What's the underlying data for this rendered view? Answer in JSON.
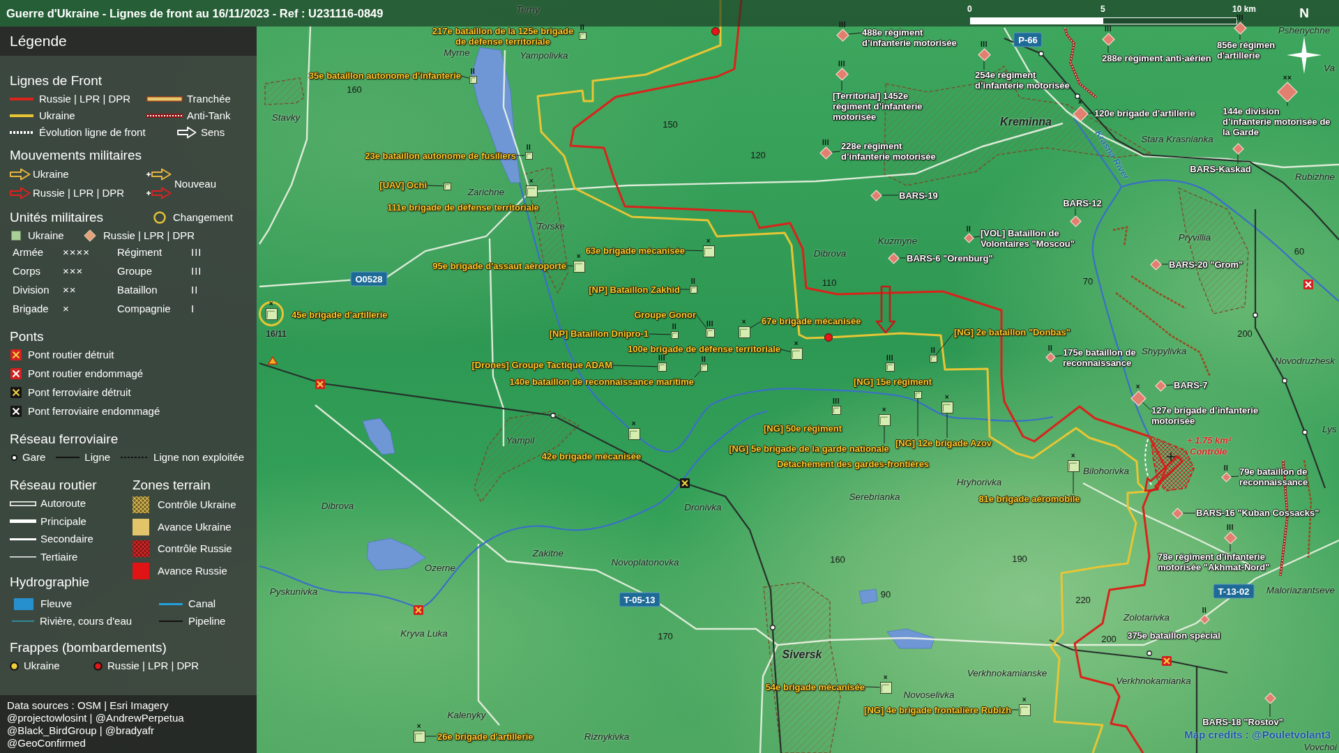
{
  "title": "Guerre d'Ukraine - Lignes de front au 16/11/2023 - Ref : U231116-0849",
  "scale_bar": {
    "ticks": [
      "0",
      "5",
      "10 km"
    ]
  },
  "compass": {
    "label": "N"
  },
  "legend": {
    "heading": "Légende",
    "front_lines": {
      "title": "Lignes de Front",
      "items": [
        {
          "kind": "russia",
          "label": "Russie | LPR | DPR"
        },
        {
          "kind": "trench",
          "label": "Tranchée"
        },
        {
          "kind": "ukraine",
          "label": "Ukraine"
        },
        {
          "kind": "anti-tank",
          "label": "Anti-Tank"
        },
        {
          "kind": "evolution",
          "label": "Évolution ligne de front"
        },
        {
          "kind": "direction",
          "label": "Sens"
        }
      ]
    },
    "movements": {
      "title": "Mouvements militaires",
      "items": [
        {
          "kind": "ukraine",
          "label": "Ukraine"
        },
        {
          "kind": "russia",
          "label": "Russie | LPR | DPR"
        }
      ],
      "new_label": "Nouveau"
    },
    "units": {
      "title": "Unités militaires",
      "change_label": "Changement",
      "sides": [
        {
          "kind": "ukraine",
          "label": "Ukraine"
        },
        {
          "kind": "russia",
          "label": "Russie | LPR | DPR"
        }
      ],
      "echelons": [
        {
          "label": "Armée",
          "mark": "××××"
        },
        {
          "label": "Régiment",
          "mark": "III"
        },
        {
          "label": "Corps",
          "mark": "×××"
        },
        {
          "label": "Groupe",
          "mark": "III"
        },
        {
          "label": "Division",
          "mark": "××"
        },
        {
          "label": "Bataillon",
          "mark": "II"
        },
        {
          "label": "Brigade",
          "mark": "×"
        },
        {
          "label": "Compagnie",
          "mark": "I"
        }
      ]
    },
    "bridges": {
      "title": "Ponts",
      "items": [
        {
          "kind": "road-destroyed",
          "label": "Pont routier détruit"
        },
        {
          "kind": "road-damaged",
          "label": "Pont routier endommagé"
        },
        {
          "kind": "rail-destroyed",
          "label": "Pont ferroviaire détruit"
        },
        {
          "kind": "rail-damaged",
          "label": "Pont ferroviaire endommagé"
        }
      ]
    },
    "railways": {
      "title": "Réseau ferroviaire",
      "items": [
        {
          "kind": "station",
          "label": "Gare"
        },
        {
          "kind": "line",
          "label": "Ligne"
        },
        {
          "kind": "disused",
          "label": "Ligne non exploitée"
        }
      ]
    },
    "roads": {
      "title": "Réseau routier",
      "items": [
        {
          "kind": "motorway",
          "label": "Autoroute"
        },
        {
          "kind": "primary",
          "label": "Principale"
        },
        {
          "kind": "secondary",
          "label": "Secondaire"
        },
        {
          "kind": "tertiary",
          "label": "Tertiaire"
        }
      ]
    },
    "zones": {
      "title": "Zones terrain",
      "items": [
        {
          "kind": "ukraine-control",
          "label": "Contrôle Ukraine"
        },
        {
          "kind": "ukraine-advance",
          "label": "Avance Ukraine"
        },
        {
          "kind": "russia-control",
          "label": "Contrôle Russie"
        },
        {
          "kind": "russia-advance",
          "label": "Avance Russie"
        }
      ]
    },
    "hydrography": {
      "title": "Hydrographie",
      "items": [
        {
          "kind": "river",
          "label": "Fleuve"
        },
        {
          "kind": "canal",
          "label": "Canal"
        },
        {
          "kind": "stream",
          "label": "Rivière, cours d'eau"
        },
        {
          "kind": "pipeline",
          "label": "Pipeline"
        }
      ]
    },
    "strikes": {
      "title": "Frappes (bombardements)",
      "items": [
        {
          "kind": "ukraine",
          "label": "Ukraine"
        },
        {
          "kind": "russia",
          "label": "Russie | LPR | DPR"
        }
      ]
    },
    "sources": [
      "Data sources : OSM | Esri Imagery",
      "@projectowlosint | @AndrewPerpetua",
      "@Black_BirdGroup | @bradyafr",
      "@GeoConfirmed"
    ]
  },
  "map": {
    "places": [
      {
        "name": "Terny",
        "kind": "village"
      },
      {
        "name": "Myrne",
        "kind": "village"
      },
      {
        "name": "Yampolivka",
        "kind": "village"
      },
      {
        "name": "Pshenychne",
        "kind": "village"
      },
      {
        "name": "Va",
        "kind": "village"
      },
      {
        "name": "Stavky",
        "kind": "village"
      },
      {
        "name": "Kreminna",
        "kind": "town"
      },
      {
        "name": "Stara Krasnianka",
        "kind": "village"
      },
      {
        "name": "Rubizhne",
        "kind": "village"
      },
      {
        "name": "Zarichne",
        "kind": "village"
      },
      {
        "name": "Torske",
        "kind": "village"
      },
      {
        "name": "Pryvillia",
        "kind": "village"
      },
      {
        "name": "Kuzmyne",
        "kind": "village"
      },
      {
        "name": "Dibrova",
        "kind": "village"
      },
      {
        "name": "Shypylivka",
        "kind": "village"
      },
      {
        "name": "Novodruzhesk",
        "kind": "village"
      },
      {
        "name": "Lys",
        "kind": "village"
      },
      {
        "name": "Yampil",
        "kind": "village"
      },
      {
        "name": "Bilohorivka",
        "kind": "village"
      },
      {
        "name": "Hryhorivka",
        "kind": "village"
      },
      {
        "name": "Serebrianka",
        "kind": "village"
      },
      {
        "name": "Dronivka",
        "kind": "village"
      },
      {
        "name": "Dibrova",
        "kind": "village"
      },
      {
        "name": "Zakitne",
        "kind": "village"
      },
      {
        "name": "Novoplatonovka",
        "kind": "village"
      },
      {
        "name": "Ozerne",
        "kind": "village"
      },
      {
        "name": "Maloriazantseve",
        "kind": "village"
      },
      {
        "name": "Pyskunivka",
        "kind": "village"
      },
      {
        "name": "Zolotarivka",
        "kind": "village"
      },
      {
        "name": "Kryva Luka",
        "kind": "village"
      },
      {
        "name": "Siversk",
        "kind": "town"
      },
      {
        "name": "Verkhnokamianske",
        "kind": "village"
      },
      {
        "name": "Verkhnokamianka",
        "kind": "village"
      },
      {
        "name": "Novoselivka",
        "kind": "village"
      },
      {
        "name": "Kalenyky",
        "kind": "village"
      },
      {
        "name": "Riznykivka",
        "kind": "village"
      },
      {
        "name": "Vovchoi",
        "kind": "village"
      }
    ],
    "elevations": [
      "160",
      "150",
      "120",
      "110",
      "70",
      "60",
      "200",
      "170",
      "160",
      "190",
      "90",
      "220",
      "200"
    ],
    "road_numbers": [
      "O0528",
      "P-66",
      "T-05-13",
      "T-13-02"
    ],
    "river_label": "Krasna River",
    "units": [
      {
        "kind": "ukraine-battalion",
        "mark": "II",
        "label": "217e bataillon de la 125e brigade\nde défense territoriale",
        "changed": false
      },
      {
        "kind": "ukraine-battalion",
        "mark": "II",
        "label": "35e bataillon autonome d’infanterie",
        "changed": false
      },
      {
        "kind": "ukraine-battalion",
        "mark": "II",
        "label": "23e bataillon autonome de fusiliers",
        "changed": false
      },
      {
        "kind": "ukraine-unit",
        "label": "[UAV] Ochi",
        "changed": false
      },
      {
        "kind": "ukraine-brigade",
        "mark": "×",
        "label": "111e brigade de défense territoriale",
        "changed": false
      },
      {
        "kind": "ukraine-brigade",
        "mark": "×",
        "label": "63e brigade mécanisée",
        "changed": false
      },
      {
        "kind": "ukraine-brigade",
        "mark": "×",
        "label": "95e brigade d'assaut aéroporté",
        "changed": false
      },
      {
        "kind": "ukraine-battalion",
        "mark": "II",
        "label": "[NP] Bataillon Zakhid",
        "changed": false
      },
      {
        "kind": "ukraine-brigade",
        "mark": "×",
        "label": "45e brigade d'artillerie",
        "changed": true,
        "change_date": "16/11"
      },
      {
        "kind": "ukraine-group",
        "mark": "III",
        "label": "Groupe Gonor",
        "changed": false
      },
      {
        "kind": "ukraine-battalion",
        "mark": "II",
        "label": "[NP] Bataillon Dnipro-1",
        "changed": false
      },
      {
        "kind": "ukraine-brigade",
        "mark": "×",
        "label": "67e brigade mécanisée",
        "changed": false
      },
      {
        "kind": "ukraine-brigade",
        "mark": "×",
        "label": "100e brigade de défense territoriale",
        "changed": false
      },
      {
        "kind": "ukraine-group",
        "mark": "III",
        "label": "[Drones] Groupe Tactique ADAM",
        "changed": false
      },
      {
        "kind": "ukraine-battalion",
        "mark": "II",
        "label": "140e bataillon de reconnaissance maritime",
        "changed": false
      },
      {
        "kind": "ukraine-brigade",
        "mark": "×",
        "label": "42e brigade mécanisée",
        "changed": false
      },
      {
        "kind": "ukraine-battalion",
        "mark": "II",
        "label": "[NG] 2e bataillon \"Donbas\"",
        "changed": false
      },
      {
        "kind": "ukraine-regiment",
        "mark": "III",
        "label": "[NG] 15e régiment",
        "changed": false
      },
      {
        "kind": "ukraine-regiment",
        "mark": "III",
        "label": "[NG] 50e régiment",
        "changed": false
      },
      {
        "kind": "ukraine-brigade",
        "mark": "×",
        "label": "[NG] 5e brigade de la garde nationale",
        "changed": false
      },
      {
        "kind": "ukraine-brigade",
        "mark": "×",
        "label": "[NG] 12e brigade Azov",
        "changed": false
      },
      {
        "kind": "ukraine-unit",
        "label": "Détachement des gardes-frontières",
        "changed": false
      },
      {
        "kind": "ukraine-brigade",
        "mark": "×",
        "label": "81e brigade aéromobile",
        "changed": false
      },
      {
        "kind": "ukraine-brigade",
        "mark": "×",
        "label": "54e brigade mécanisée",
        "changed": false
      },
      {
        "kind": "ukraine-brigade",
        "mark": "×",
        "label": "[NG] 4e brigade frontalière Rubizh",
        "changed": false
      },
      {
        "kind": "ukraine-brigade",
        "mark": "×",
        "label": "26e brigade d'artillerie",
        "changed": false
      },
      {
        "kind": "russia-regiment",
        "mark": "III",
        "label": "488e régiment\nd’infanterie motorisée",
        "changed": false
      },
      {
        "kind": "russia-regiment",
        "mark": "III",
        "label": "254e régiment\nd’infanterie motorisée",
        "changed": false
      },
      {
        "kind": "russia-regiment",
        "mark": "III",
        "label": "[Territorial] 1452e\nrégiment d’infanterie\nmotorisée",
        "changed": false
      },
      {
        "kind": "russia-regiment",
        "mark": "III",
        "label": "288e régiment anti-aérien",
        "changed": false
      },
      {
        "kind": "russia-regiment",
        "mark": "III",
        "label": "856e régimen\nd'artillerie",
        "changed": false
      },
      {
        "kind": "russia-brigade",
        "mark": "×",
        "label": "120e brigade d'artillerie",
        "changed": false
      },
      {
        "kind": "russia-division",
        "mark": "××",
        "label": "144e division\nd’infanterie motorisée de\nla Garde",
        "changed": false
      },
      {
        "kind": "russia-regiment",
        "mark": "III",
        "label": "228e régiment\nd’infanterie motorisée",
        "changed": false
      },
      {
        "kind": "russia-unit",
        "label": "BARS-Kaskad",
        "changed": false
      },
      {
        "kind": "russia-unit",
        "label": "BARS-19",
        "changed": false
      },
      {
        "kind": "russia-unit",
        "label": "BARS-12",
        "changed": false
      },
      {
        "kind": "russia-battalion",
        "mark": "II",
        "label": "[VOL] Bataillon de\nVolontaires \"Moscou\"",
        "changed": false
      },
      {
        "kind": "russia-unit",
        "label": "BARS-6 \"Orenburg\"",
        "changed": false
      },
      {
        "kind": "russia-unit",
        "label": "BARS-20 \"Grom\"",
        "changed": false
      },
      {
        "kind": "russia-battalion",
        "mark": "II",
        "label": "175e bataillon de\nreconnaissance",
        "changed": false
      },
      {
        "kind": "russia-unit",
        "label": "BARS-7",
        "changed": false
      },
      {
        "kind": "russia-brigade",
        "mark": "×",
        "label": "127e brigade d’infanterie\nmotorisée",
        "changed": false
      },
      {
        "kind": "russia-battalion",
        "mark": "II",
        "label": "79e bataillon de\nreconnaissance",
        "changed": false
      },
      {
        "kind": "russia-unit",
        "label": "BARS-16 \"Kuban Cossacks\"",
        "changed": false
      },
      {
        "kind": "russia-regiment",
        "mark": "III",
        "label": "78e régiment d’infanterie\nmotorisée \"Akhmat-Nord\"",
        "changed": false
      },
      {
        "kind": "russia-battalion",
        "mark": "II",
        "label": "375e bataillon spécial",
        "changed": false
      },
      {
        "kind": "russia-unit",
        "label": "BARS-18 \"Rostov\"",
        "changed": false
      }
    ],
    "bridges": [
      {
        "kind": "road-destroyed"
      },
      {
        "kind": "rail-destroyed"
      },
      {
        "kind": "road-destroyed"
      },
      {
        "kind": "road-damaged"
      },
      {
        "kind": "road-destroyed"
      }
    ],
    "strikes": [
      {
        "kind": "russia"
      },
      {
        "kind": "russia"
      }
    ],
    "gain": {
      "area": "+ 1.75 km²",
      "status": "Contrôle"
    },
    "credits": "Map credits : @Pouletvolant3"
  }
}
